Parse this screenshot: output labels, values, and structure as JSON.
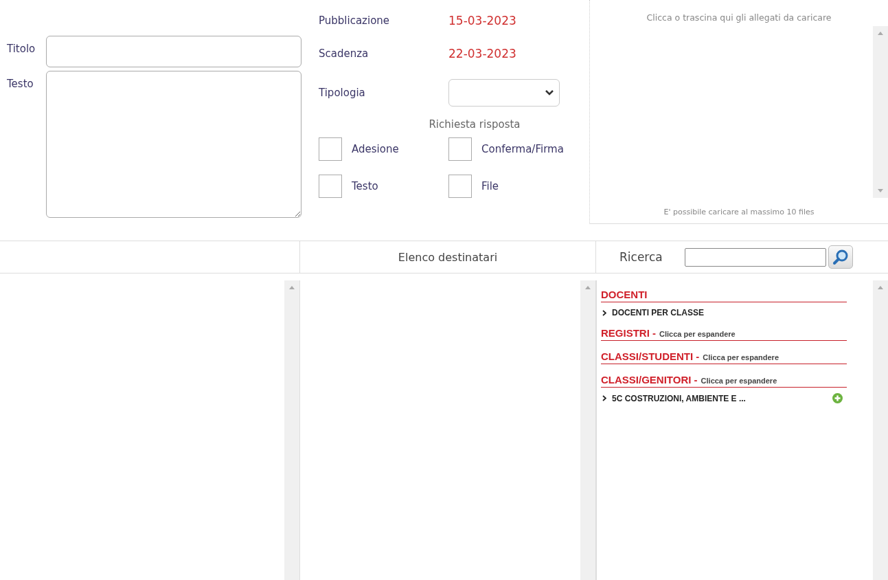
{
  "form": {
    "title_label": "Titolo",
    "text_label": "Testo"
  },
  "dates": [
    {
      "label": "Pubblicazione",
      "value": "15-03-2023"
    },
    {
      "label": "Scadenza",
      "value": "22-03-2023"
    }
  ],
  "type_field": {
    "label": "Tipologia"
  },
  "response": {
    "title": "Richiesta risposta",
    "options": [
      {
        "label": "Adesione",
        "checked": false
      },
      {
        "label": "Conferma/Firma",
        "checked": false
      },
      {
        "label": "Testo",
        "checked": false
      },
      {
        "label": "File",
        "checked": false
      }
    ]
  },
  "upload": {
    "prompt": "Clicca o trascina qui gli allegati da caricare",
    "note": "E' possibile caricare al massimo 10 files"
  },
  "recipients": {
    "header": "Elenco destinatari"
  },
  "search": {
    "label": "Ricerca"
  },
  "groups": [
    {
      "title": "DOCENTI",
      "children": [
        {
          "label": "DOCENTI PER CLASSE",
          "addable": false
        }
      ]
    },
    {
      "title": "REGISTRI -",
      "hint": "Clicca per espandere"
    },
    {
      "title": "CLASSI/STUDENTI -",
      "hint": "Clicca per espandere"
    },
    {
      "title": "CLASSI/GENITORI -",
      "hint": "Clicca per espandere",
      "children": [
        {
          "label": "5C COSTRUZIONI, AMBIENTE E ...",
          "addable": true
        }
      ]
    }
  ]
}
